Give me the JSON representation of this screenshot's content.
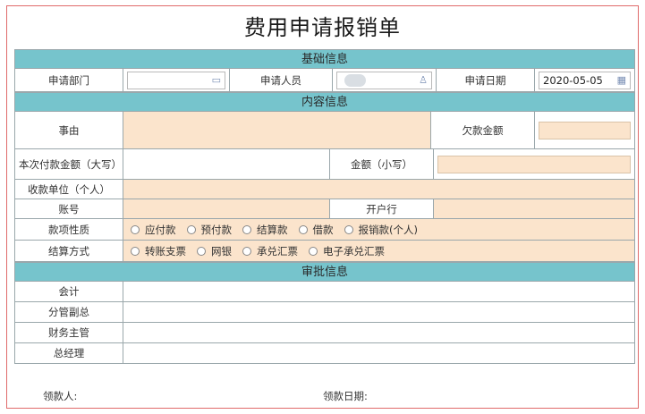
{
  "title": "费用申请报销单",
  "sections": {
    "basic": "基础信息",
    "content": "内容信息",
    "approval": "审批信息"
  },
  "basic": {
    "dept_label": "申请部门",
    "person_label": "申请人员",
    "date_label": "申请日期",
    "date_value": "2020-05-05"
  },
  "content": {
    "reason_label": "事由",
    "debt_label": "欠款金额",
    "pay_amount_label": "本次付款金额（大写）",
    "amount_small_label": "金额（小写）",
    "payee_label": "收款单位（个人）",
    "account_label": "账号",
    "bank_label": "开户行",
    "nature_label": "款项性质",
    "nature_options": [
      "应付款",
      "预付款",
      "结算款",
      "借款",
      "报销款(个人)"
    ],
    "settle_label": "结算方式",
    "settle_options": [
      "转账支票",
      "网银",
      "承兑汇票",
      "电子承兑汇票"
    ]
  },
  "approval": {
    "rows": [
      "会计",
      "分管副总",
      "财务主管",
      "总经理"
    ]
  },
  "footer": {
    "receiver_label": "领款人:",
    "receive_date_label": "领款日期:"
  },
  "icons": {
    "dept": "building-icon",
    "person": "user-icon",
    "date": "calendar-icon"
  }
}
